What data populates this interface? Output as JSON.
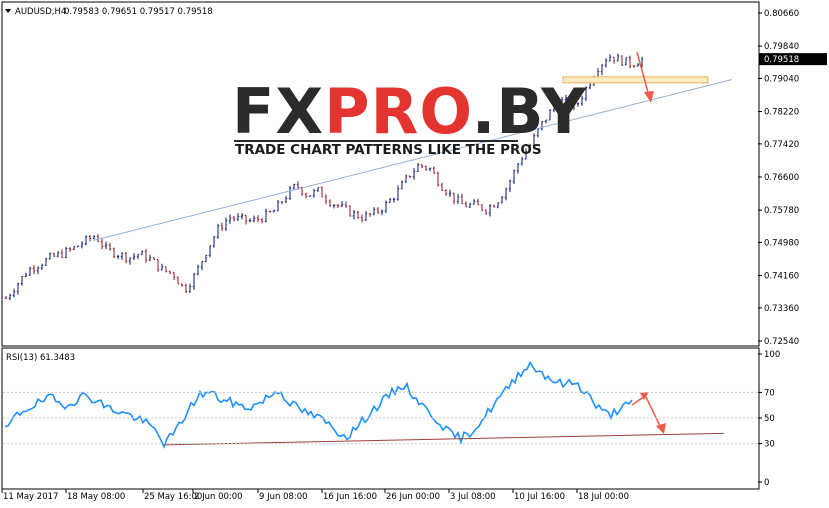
{
  "header": {
    "symbol": "AUDUSD,H4",
    "ohlc": "0.79583 0.79651 0.79517 0.79518"
  },
  "rsi_header": "RSI(13) 61.3483",
  "logo": {
    "part1": "FX",
    "part2": "PRO",
    "part3": ".BY",
    "tagline": "TRADE CHART PATTERNS LIKE THE PROS"
  },
  "colors": {
    "bull": "#0a1a6e",
    "bear": "#8b1a2b",
    "rsi_line": "#1e90ff",
    "trendline_main": "#8fb3d8",
    "trendline_rsi": "#a0403a",
    "arrow": "#ef5a4a",
    "zone_fill": "#fdebc8",
    "zone_stroke": "#f0b050",
    "logo_red": "#e3342f",
    "logo_dark": "#2b2b2b"
  },
  "chart_data": [
    {
      "type": "candlestick",
      "title": "AUDUSD,H4",
      "y_ticks": [
        "0.80660",
        "0.79840",
        "0.79040",
        "0.78220",
        "0.77420",
        "0.76600",
        "0.75780",
        "0.74980",
        "0.74160",
        "0.73360",
        "0.72540"
      ],
      "ylim": [
        0.7254,
        0.8066
      ],
      "current_price": "0.79518",
      "x_ticks": [
        "11 May 2017",
        "18 May 08:00",
        "25 May 16:00",
        "2 Jun 00:00",
        "9 Jun 08:00",
        "16 Jun 16:00",
        "26 Jun 00:00",
        "3 Jul 08:00",
        "10 Jul 16:00",
        "18 Jul 00:00"
      ],
      "close_path": [
        0.736,
        0.7395,
        0.743,
        0.7445,
        0.746,
        0.747,
        0.7482,
        0.75,
        0.7515,
        0.748,
        0.747,
        0.746,
        0.747,
        0.7455,
        0.743,
        0.742,
        0.738,
        0.742,
        0.748,
        0.753,
        0.756,
        0.7555,
        0.755,
        0.756,
        0.7575,
        0.761,
        0.764,
        0.7615,
        0.7625,
        0.76,
        0.7585,
        0.757,
        0.756,
        0.757,
        0.759,
        0.762,
        0.766,
        0.769,
        0.768,
        0.764,
        0.761,
        0.759,
        0.759,
        0.758,
        0.76,
        0.764,
        0.77,
        0.774,
        0.779,
        0.783,
        0.785,
        0.783,
        0.788,
        0.793,
        0.796,
        0.795,
        0.794,
        0.795
      ],
      "trendline": {
        "from": {
          "x_frac": 0.12,
          "price": 0.7503
        },
        "to": {
          "x_frac": 0.965,
          "price": 0.7901
        }
      },
      "resistance_zone": {
        "price_top": 0.7908,
        "price_bottom": 0.7898
      }
    },
    {
      "type": "line",
      "title": "RSI(13) 61.3483",
      "series": [
        {
          "name": "RSI(13)",
          "values": [
            40,
            52,
            58,
            62,
            66,
            60,
            63,
            68,
            64,
            58,
            55,
            52,
            48,
            42,
            30,
            40,
            55,
            68,
            70,
            64,
            62,
            58,
            60,
            66,
            72,
            62,
            56,
            52,
            48,
            40,
            36,
            44,
            54,
            62,
            70,
            76,
            66,
            56,
            48,
            38,
            34,
            40,
            50,
            62,
            72,
            84,
            92,
            86,
            80,
            76,
            78,
            70,
            58,
            52,
            58,
            61.3
          ]
        }
      ],
      "y_ticks": [
        "100",
        "70",
        "50",
        "30",
        "0"
      ],
      "ylim": [
        0,
        100
      ],
      "trendline": {
        "from": {
          "x_frac": 0.22,
          "value": 29
        },
        "to": {
          "x_frac": 0.965,
          "value": 38
        }
      }
    }
  ]
}
